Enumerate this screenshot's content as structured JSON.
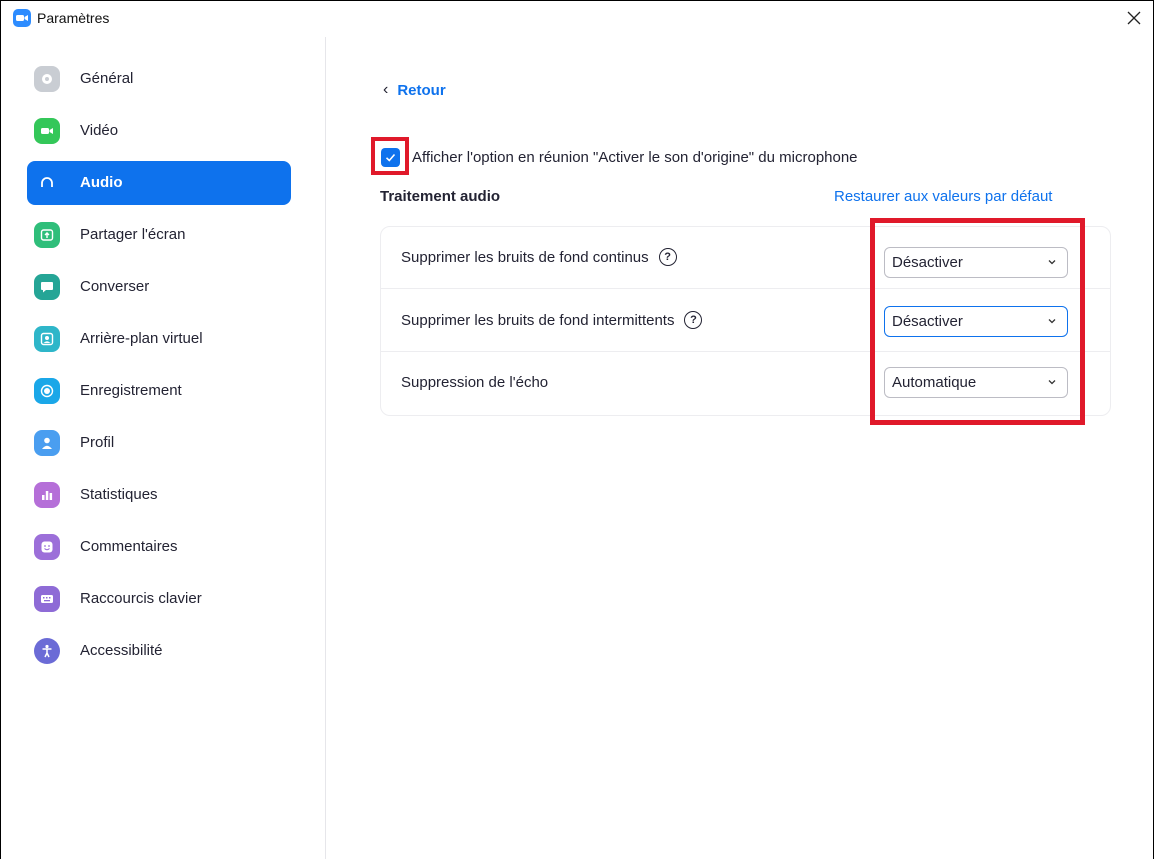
{
  "window": {
    "title": "Paramètres"
  },
  "sidebar": {
    "items": [
      {
        "label": "Général",
        "icon": "gear-icon",
        "color": "#C9CDD3",
        "active": false
      },
      {
        "label": "Vidéo",
        "icon": "video-camera-icon",
        "color": "#34C759",
        "active": false
      },
      {
        "label": "Audio",
        "icon": "headphones-icon",
        "color": "#0E72ED",
        "active": true
      },
      {
        "label": "Partager l'écran",
        "icon": "share-screen-icon",
        "color": "#2FBE7A",
        "active": false
      },
      {
        "label": "Converser",
        "icon": "chat-icon",
        "color": "#25A596",
        "active": false
      },
      {
        "label": "Arrière-plan virtuel",
        "icon": "virtual-background-icon",
        "color": "#2EB6C9",
        "active": false
      },
      {
        "label": "Enregistrement",
        "icon": "record-icon",
        "color": "#1AA7E8",
        "active": false
      },
      {
        "label": "Profil",
        "icon": "profile-icon",
        "color": "#4A9EF0",
        "active": false
      },
      {
        "label": "Statistiques",
        "icon": "statistics-icon",
        "color": "#B56FD8",
        "active": false
      },
      {
        "label": "Commentaires",
        "icon": "feedback-smile-icon",
        "color": "#9C6FD9",
        "active": false
      },
      {
        "label": "Raccourcis clavier",
        "icon": "keyboard-icon",
        "color": "#8E6BD6",
        "active": false
      },
      {
        "label": "Accessibilité",
        "icon": "accessibility-icon",
        "color": "#6B6BD6",
        "active": false
      }
    ]
  },
  "content": {
    "back_label": "Retour",
    "checkbox_label": "Afficher l'option en réunion \"Activer le son d'origine\" du microphone",
    "checkbox_checked": true,
    "section_title": "Traitement audio",
    "restore_label": "Restaurer aux valeurs par défaut",
    "settings": [
      {
        "label": "Supprimer les bruits de fond continus",
        "value": "Désactiver",
        "help": true
      },
      {
        "label": "Supprimer les bruits de fond intermittents",
        "value": "Désactiver",
        "help": true
      },
      {
        "label": "Suppression de l'écho",
        "value": "Automatique",
        "help": false
      }
    ],
    "help_glyph": "?"
  },
  "colors": {
    "accent": "#0E72ED",
    "highlight": "#E0192A"
  }
}
